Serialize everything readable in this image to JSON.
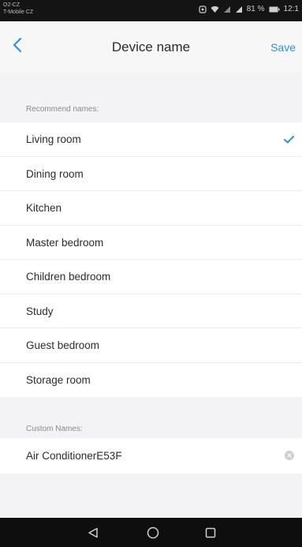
{
  "status_bar": {
    "carrier_line1": "O2-CZ",
    "carrier_line2": "T-Mobile CZ",
    "battery": "81 %",
    "time": "12:1"
  },
  "header": {
    "title": "Device name",
    "save_label": "Save",
    "back_icon": "chevron-left-icon",
    "accent_color": "#2f8fe0"
  },
  "recommend": {
    "header": "Recommend names:",
    "selected": "Living room",
    "items": [
      {
        "label": "Living room"
      },
      {
        "label": "Dining room"
      },
      {
        "label": "Kitchen"
      },
      {
        "label": "Master bedroom"
      },
      {
        "label": "Children bedroom"
      },
      {
        "label": "Study"
      },
      {
        "label": "Guest bedroom"
      },
      {
        "label": "Storage room"
      }
    ]
  },
  "custom": {
    "header": "Custom Names:",
    "value": "Air ConditionerE53F"
  },
  "system_nav": {
    "icons": [
      "back-triangle-icon",
      "home-circle-icon",
      "recents-square-icon"
    ]
  }
}
